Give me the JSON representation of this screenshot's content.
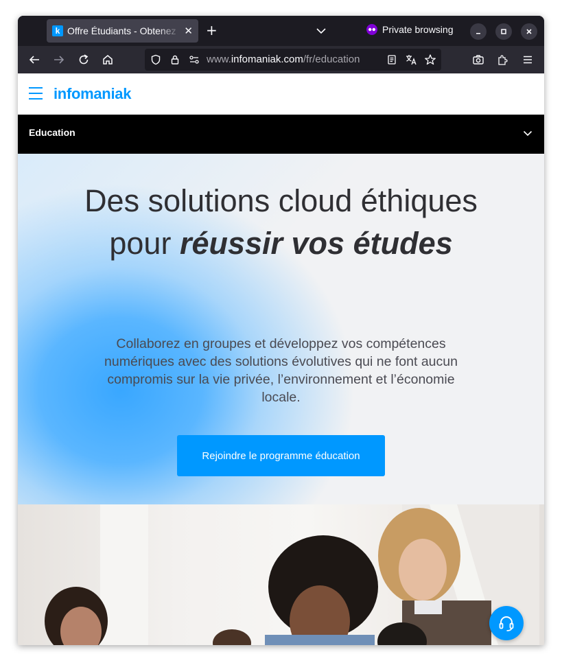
{
  "browser": {
    "tab_title": "Offre Étudiants - Obtenez",
    "tab_favicon_letter": "k",
    "private_label": "Private browsing",
    "url_prefix": "www.",
    "url_host": "infomaniak.com",
    "url_path": "/fr/education"
  },
  "site": {
    "logo": "infomaniak",
    "section_label": "Education"
  },
  "hero": {
    "title_plain": "Des solutions cloud éthiques pour ",
    "title_emphasis": "réussir vos études",
    "description": "Collaborez en groupes et développez vos compétences numériques avec des solutions évolutives qui ne font aucun compromis sur la vie privée, l’environnement et l’économie locale.",
    "cta_label": "Rejoindre le programme éducation"
  },
  "colors": {
    "brand": "#0098ff",
    "section_bar": "#000000",
    "hero_text": "#2f2f33"
  }
}
